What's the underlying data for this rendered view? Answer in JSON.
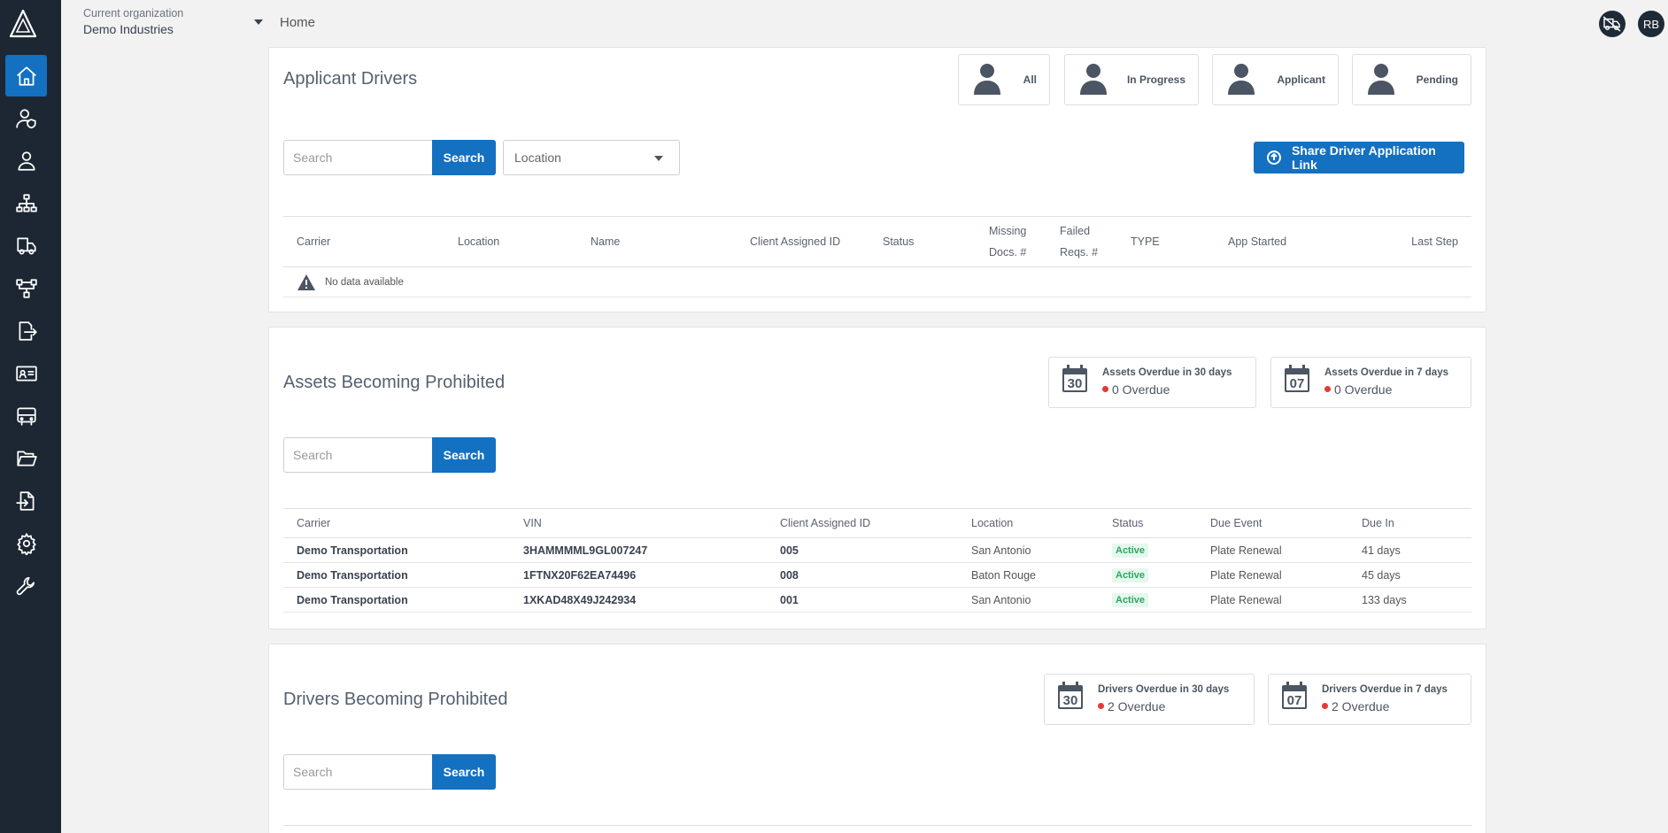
{
  "app": {
    "user_initials": "RB"
  },
  "header": {
    "org_label": "Current organization",
    "org_name": "Demo Industries",
    "breadcrumb": "Home"
  },
  "sidebar": {
    "items": [
      {
        "icon": "home-icon",
        "active": true
      },
      {
        "icon": "user-shield-icon"
      },
      {
        "icon": "user-icon"
      },
      {
        "icon": "org-chart-icon"
      },
      {
        "icon": "truck-icon"
      },
      {
        "icon": "network-icon"
      },
      {
        "icon": "file-export-icon"
      },
      {
        "icon": "id-card-icon"
      },
      {
        "icon": "bus-icon"
      },
      {
        "icon": "folder-open-icon"
      },
      {
        "icon": "file-import-icon"
      },
      {
        "icon": "gear-icon"
      },
      {
        "icon": "wrench-icon"
      }
    ]
  },
  "applicant": {
    "title": "Applicant Drivers",
    "filters": [
      "All",
      "In Progress",
      "Applicant",
      "Pending"
    ],
    "search_placeholder": "Search",
    "search_label": "Search",
    "location_placeholder": "Location",
    "share_label": "Share Driver Application Link",
    "columns": [
      "Carrier",
      "Location",
      "Name",
      "Client Assigned ID",
      "Status",
      "Missing Docs. #",
      "Failed Reqs. #",
      "TYPE",
      "App Started",
      "Last Step"
    ],
    "columns_split": [
      [
        "Missing",
        "Docs. #"
      ],
      [
        "Failed",
        "Reqs. #"
      ]
    ],
    "no_data": "No data available"
  },
  "assets": {
    "title": "Assets Becoming Prohibited",
    "search_placeholder": "Search",
    "search_label": "Search",
    "overdue": [
      {
        "cal": "30",
        "title": "Assets Overdue in 30 days",
        "count": "0 Overdue"
      },
      {
        "cal": "07",
        "title": "Assets Overdue in 7 days",
        "count": "0 Overdue"
      }
    ],
    "columns": [
      "Carrier",
      "VIN",
      "Client Assigned ID",
      "Location",
      "Status",
      "Due Event",
      "Due In"
    ],
    "rows": [
      {
        "carrier": "Demo Transportation",
        "vin": "3HAMMMML9GL007247",
        "cid": "005",
        "location": "San Antonio",
        "status": "Active",
        "event": "Plate Renewal",
        "due": "41 days"
      },
      {
        "carrier": "Demo Transportation",
        "vin": "1FTNX20F62EA74496",
        "cid": "008",
        "location": "Baton Rouge",
        "status": "Active",
        "event": "Plate Renewal",
        "due": "45 days"
      },
      {
        "carrier": "Demo Transportation",
        "vin": "1XKAD48X49J242934",
        "cid": "001",
        "location": "San Antonio",
        "status": "Active",
        "event": "Plate Renewal",
        "due": "133 days"
      }
    ]
  },
  "drivers": {
    "title": "Drivers Becoming Prohibited",
    "search_placeholder": "Search",
    "search_label": "Search",
    "overdue": [
      {
        "cal": "30",
        "title": "Drivers Overdue in 30 days",
        "count": "2 Overdue"
      },
      {
        "cal": "07",
        "title": "Drivers Overdue in 7 days",
        "count": "2 Overdue"
      }
    ]
  },
  "colors": {
    "sidebar": "#1c2733",
    "primary": "#1470c0",
    "danger": "#e53935",
    "success": "#2aa861"
  }
}
